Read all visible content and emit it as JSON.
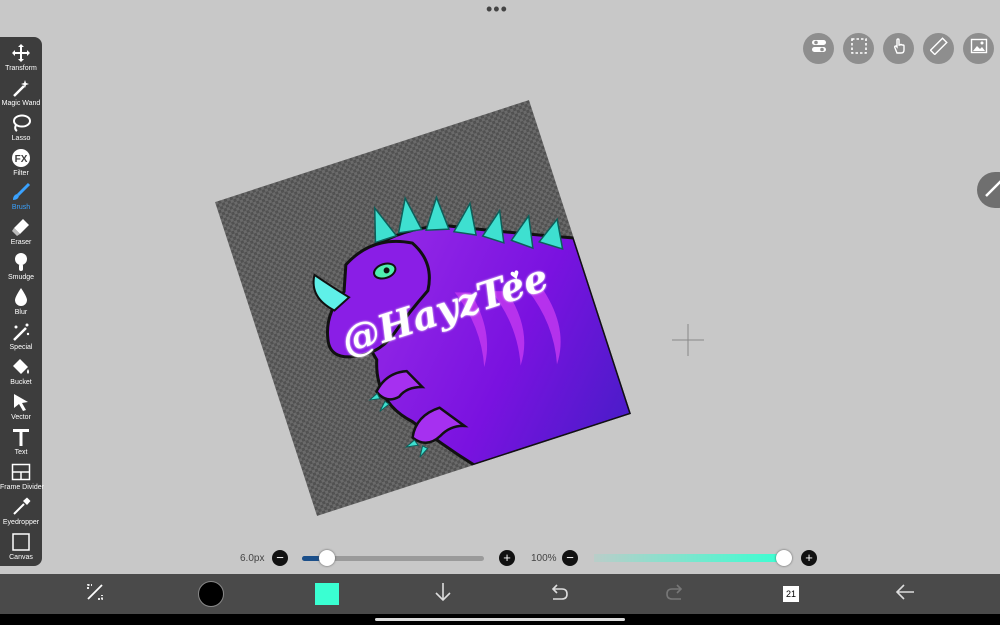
{
  "toolbar": {
    "tools": [
      {
        "label": "Transform",
        "icon": "move-icon"
      },
      {
        "label": "Magic Wand",
        "icon": "magic-wand-icon"
      },
      {
        "label": "Lasso",
        "icon": "lasso-icon"
      },
      {
        "label": "Filter",
        "icon": "fx-icon"
      },
      {
        "label": "Brush",
        "icon": "brush-icon",
        "active": true
      },
      {
        "label": "Eraser",
        "icon": "eraser-icon"
      },
      {
        "label": "Smudge",
        "icon": "smudge-icon"
      },
      {
        "label": "Blur",
        "icon": "droplet-icon"
      },
      {
        "label": "Special",
        "icon": "special-icon"
      },
      {
        "label": "Bucket",
        "icon": "bucket-icon"
      },
      {
        "label": "Vector",
        "icon": "cursor-icon"
      },
      {
        "label": "Text",
        "icon": "text-icon"
      },
      {
        "label": "Frame Divider",
        "icon": "frame-divider-icon"
      },
      {
        "label": "Eyedropper",
        "icon": "eyedropper-icon"
      },
      {
        "label": "Canvas",
        "icon": "canvas-icon"
      }
    ]
  },
  "artwork": {
    "signature": "@HayzTee"
  },
  "brush": {
    "size_label": "6.0px",
    "size_fraction": 0.14,
    "opacity_label": "100%",
    "opacity_fraction": 1.0,
    "minus": "−",
    "plus": "+"
  },
  "bottombar": {
    "layer_count": "21",
    "main_color": "#000000",
    "secondary_color": "#3affd2"
  },
  "colors": {
    "accent": "#3aa2ff",
    "toolbar_bg": "#3d3d3d"
  }
}
